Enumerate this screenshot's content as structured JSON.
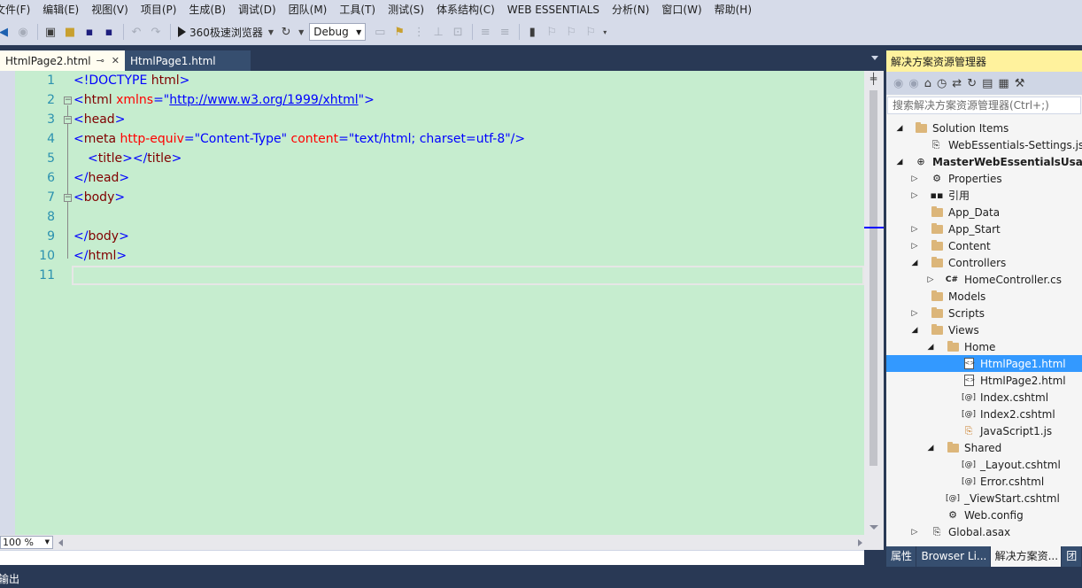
{
  "menu": [
    "文件(F)",
    "编辑(E)",
    "视图(V)",
    "项目(P)",
    "生成(B)",
    "调试(D)",
    "团队(M)",
    "工具(T)",
    "测试(S)",
    "体系结构(C)",
    "WEB ESSENTIALS",
    "分析(N)",
    "窗口(W)",
    "帮助(H)"
  ],
  "toolbar": {
    "browser_label": "360极速浏览器",
    "config_value": "Debug"
  },
  "doc_tabs": [
    {
      "label": "HtmlPage2.html",
      "active": true
    },
    {
      "label": "HtmlPage1.html",
      "active": false
    }
  ],
  "editor": {
    "lines": [
      {
        "num": "1"
      },
      {
        "num": "2"
      },
      {
        "num": "3"
      },
      {
        "num": "4"
      },
      {
        "num": "5"
      },
      {
        "num": "6"
      },
      {
        "num": "7"
      },
      {
        "num": "8"
      },
      {
        "num": "9"
      },
      {
        "num": "10"
      },
      {
        "num": "11"
      }
    ],
    "code": {
      "l1_a": "<!DOCTYPE ",
      "l1_b": "html",
      "l1_c": ">",
      "l2_open": "<",
      "l2_tag": "html",
      "l2_attr": " xmlns",
      "l2_eq": "=\"",
      "l2_url": "http://www.w3.org/1999/xhtml",
      "l2_close": "\">",
      "l3_open": "<",
      "l3_tag": "head",
      "l3_close": ">",
      "l4_open": "<",
      "l4_tag": "meta",
      "l4_attr1": " http-equiv",
      "l4_val1": "=\"Content-Type\"",
      "l4_attr2": " content",
      "l4_val2": "=\"text/html; charset=utf-8\"",
      "l4_close": "/>",
      "l5_open": "<",
      "l5_tag": "title",
      "l5_mid": "></",
      "l5_tag2": "title",
      "l5_close": ">",
      "l6_open": "</",
      "l6_tag": "head",
      "l6_close": ">",
      "l7_open": "<",
      "l7_tag": "body",
      "l7_close": ">",
      "l9_open": "</",
      "l9_tag": "body",
      "l9_close": ">",
      "l10_open": "</",
      "l10_tag": "html",
      "l10_close": ">"
    },
    "zoom": "100 %"
  },
  "solution_explorer": {
    "title": "解决方案资源管理器",
    "search_placeholder": "搜索解决方案资源管理器(Ctrl+;)",
    "nodes": [
      {
        "label": "Solution Items",
        "icon": "folder"
      },
      {
        "label": "WebEssentials-Settings.json",
        "icon": "json-file"
      },
      {
        "label": "MasterWebEssentialsUsage",
        "icon": "web-project"
      },
      {
        "label": "Properties",
        "icon": "wrench"
      },
      {
        "label": "引用",
        "icon": "references"
      },
      {
        "label": "App_Data",
        "icon": "folder"
      },
      {
        "label": "App_Start",
        "icon": "folder"
      },
      {
        "label": "Content",
        "icon": "folder"
      },
      {
        "label": "Controllers",
        "icon": "folder"
      },
      {
        "label": "HomeController.cs",
        "icon": "csharp-file"
      },
      {
        "label": "Models",
        "icon": "folder"
      },
      {
        "label": "Scripts",
        "icon": "folder"
      },
      {
        "label": "Views",
        "icon": "folder"
      },
      {
        "label": "Home",
        "icon": "folder"
      },
      {
        "label": "HtmlPage1.html",
        "icon": "html-file"
      },
      {
        "label": "HtmlPage2.html",
        "icon": "html-file"
      },
      {
        "label": "Index.cshtml",
        "icon": "razor-file"
      },
      {
        "label": "Index2.cshtml",
        "icon": "razor-file"
      },
      {
        "label": "JavaScript1.js",
        "icon": "js-file"
      },
      {
        "label": "Shared",
        "icon": "folder"
      },
      {
        "label": "_Layout.cshtml",
        "icon": "razor-file"
      },
      {
        "label": "Error.cshtml",
        "icon": "razor-file"
      },
      {
        "label": "_ViewStart.cshtml",
        "icon": "razor-file"
      },
      {
        "label": "Web.config",
        "icon": "config-file"
      },
      {
        "label": "Global.asax",
        "icon": "asax-file"
      }
    ],
    "bottom_tabs": [
      "属性",
      "Browser Li...",
      "解决方案资...",
      "团"
    ]
  },
  "output_label": "输出"
}
